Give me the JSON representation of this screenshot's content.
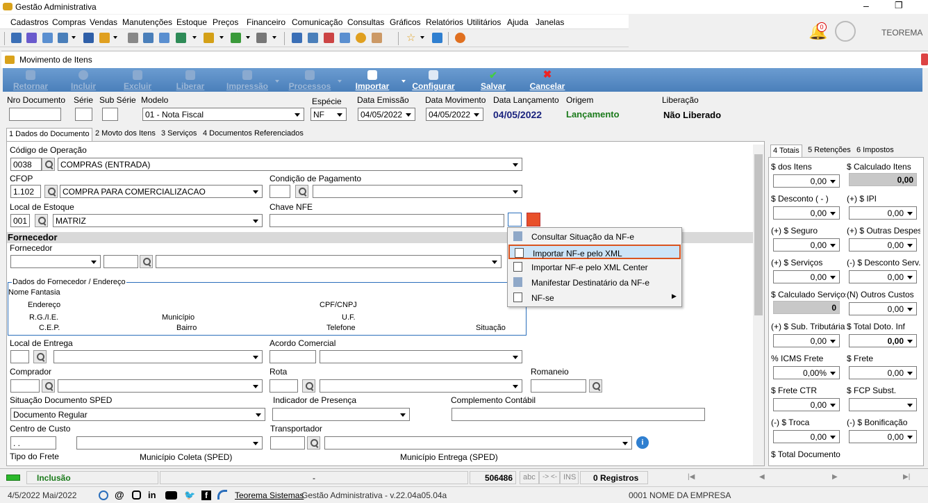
{
  "app": {
    "title": "Gestão Administrativa"
  },
  "menu": [
    "Cadastros",
    "Compras",
    "Vendas",
    "Manutenções",
    "Estoque",
    "Preços",
    "Financeiro",
    "Comunicação",
    "Consultas",
    "Gráficos",
    "Relatórios",
    "Utilitários",
    "Ajuda",
    "Janelas"
  ],
  "notifications": {
    "count": "0"
  },
  "user": {
    "name": "TEOREMA"
  },
  "form": {
    "title": "Movimento de Itens"
  },
  "actions": {
    "retornar": "Retornar",
    "incluir": "Incluir",
    "excluir": "Excluir",
    "liberar": "Liberar",
    "impressao": "Impressão",
    "processos": "Processos",
    "importar": "Importar",
    "configurar": "Configurar",
    "salvar": "Salvar",
    "cancelar": "Cancelar"
  },
  "header": {
    "nro_label": "Nro Documento",
    "nro_value": "",
    "serie_label": "Série",
    "serie_value": "",
    "subserie_label": "Sub Série",
    "subserie_value": "",
    "modelo_label": "Modelo",
    "modelo_value": "01 - Nota Fiscal",
    "especie_label": "Espécie",
    "especie_value": "NF",
    "emissao_label": "Data Emissão",
    "emissao_value": "04/05/2022",
    "movimento_label": "Data Movimento",
    "movimento_value": "04/05/2022",
    "lancamento_label": "Data Lançamento",
    "lancamento_value": "04/05/2022",
    "origem_label": "Origem",
    "origem_value": "Lançamento",
    "liberacao_label": "Liberação",
    "liberacao_value": "Não Liberado"
  },
  "tabs": [
    "1 Dados do Documento",
    "2 Movto dos Itens",
    "3 Serviços",
    "4 Documentos Referenciados"
  ],
  "fields": {
    "codop_label": "Código de Operação",
    "codop_code": "0038",
    "codop_value": "COMPRAS (ENTRADA)",
    "cfop_label": "CFOP",
    "cfop_code": "1.102",
    "cfop_value": "COMPRA PARA COMERCIALIZACAO",
    "condpag_label": "Condição de Pagamento",
    "local_label": "Local de Estoque",
    "local_code": "001",
    "local_value": "MATRIZ",
    "chave_label": "Chave NFE",
    "fornecedor_section": "Fornecedor",
    "fornecedor_label": "Fornecedor",
    "dados_group": "Dados do Fornecedor / Endereço",
    "nome_fantasia": "Nome Fantasia",
    "endereco": "Endereço",
    "rgie": "R.G./I.E.",
    "municipio": "Município",
    "cep": "C.E.P.",
    "bairro": "Bairro",
    "cpfcnpj": "CPF/CNPJ",
    "uf": "U.F.",
    "telefone": "Telefone",
    "situacao": "Situação",
    "entrega_label": "Local de Entrega",
    "acordo_label": "Acordo Comercial",
    "comprador_label": "Comprador",
    "rota_label": "Rota",
    "romaneio_label": "Romaneio",
    "sped_label": "Situação Documento SPED",
    "sped_value": "Documento Regular",
    "presenca_label": "Indicador de Presença",
    "contabil_label": "Complemento Contábil",
    "custo_label": "Centro de Custo",
    "custo_value": " .  .",
    "transp_label": "Transportador",
    "frete_label": "Tipo do Frete",
    "coleta_label": "Município Coleta (SPED)",
    "entrega_mun_label": "Município Entrega (SPED)"
  },
  "context_menu": [
    "Consultar Situação da NF-e",
    "Importar NF-e pelo XML",
    "Importar NF-e pelo XML Center",
    "Manifestar Destinatário da NF-e",
    "NF-se"
  ],
  "right_tabs": [
    "4 Totais",
    "5 Retenções",
    "6 Impostos"
  ],
  "totals": [
    {
      "l": "$ dos Itens",
      "v": "0,00",
      "l2": "$ Calculado Itens",
      "v2": "0,00"
    },
    {
      "l": "$ Desconto ( - )",
      "v": "0,00",
      "l2": "(+) $ IPI",
      "v2": "0,00"
    },
    {
      "l": "(+) $ Seguro",
      "v": "0,00",
      "l2": "(+) $ Outras Despesas",
      "v2": "0,00"
    },
    {
      "l": "(+) $ Serviços",
      "v": "0,00",
      "l2": "(-) $ Desconto Serv.",
      "v2": "0,00"
    },
    {
      "l": "$ Calculado Serviços",
      "v": "0",
      "l2": "(N) Outros Custos",
      "v2": "0,00"
    },
    {
      "l": "(+) $ Sub. Tributária",
      "v": "0,00",
      "l2": "$ Total Doto. Inf",
      "v2": "0,00"
    },
    {
      "l": "% ICMS Frete",
      "v": "0,00%",
      "l2": "$ Frete",
      "v2": "0,00"
    },
    {
      "l": "$ Frete CTR",
      "v": "0,00",
      "l2": "$ FCP Subst.",
      "v2": ""
    },
    {
      "l": "(-) $ Troca",
      "v": "0,00",
      "l2": "(-) $ Bonificação",
      "v2": "0,00"
    },
    {
      "l": "$ Total Documento",
      "v": "",
      "l2": "",
      "v2": ""
    }
  ],
  "status": {
    "mode": "Inclusão",
    "dash": "-",
    "number": "506486",
    "abc": "abc",
    "arrows": "-> <-",
    "ins": "INS",
    "registros": "0 Registros"
  },
  "footer": {
    "date": "4/5/2022 Mai/2022",
    "company_link": "Teorema Sistemas",
    "version": "Gestão Administrativa - v.22.04a05.04a",
    "empresa": "0001 NOME DA EMPRESA"
  },
  "colors": {
    "accent": "#4a7fba",
    "highlight": "#cce4f7",
    "origem": "#1a7a1a",
    "date_blue": "#1a237e"
  }
}
